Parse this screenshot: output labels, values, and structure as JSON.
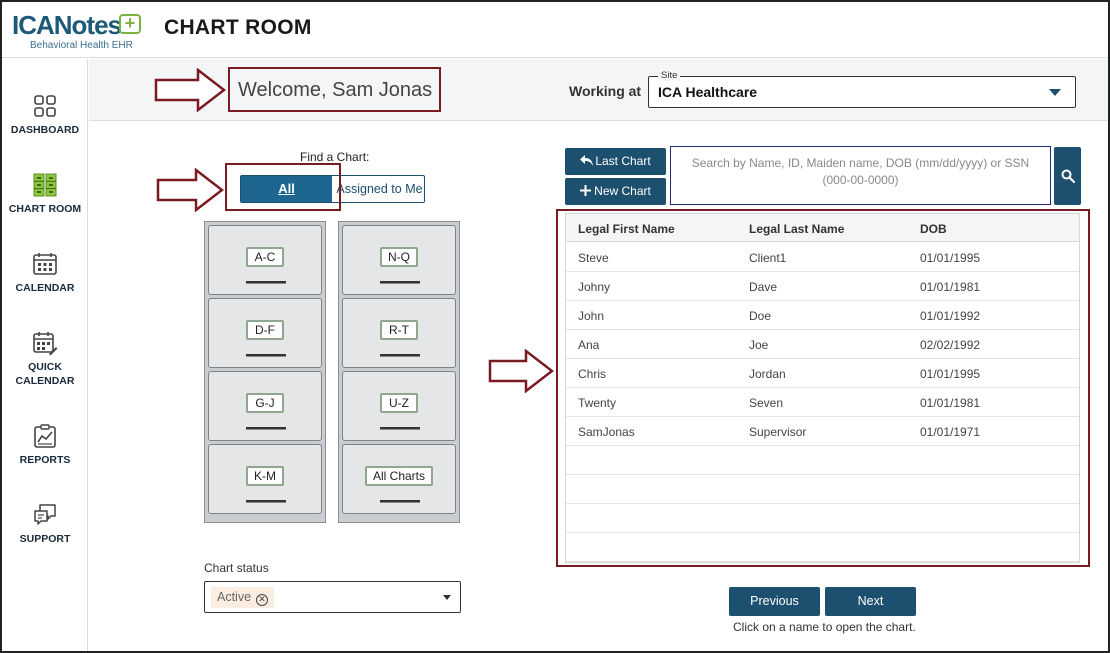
{
  "header": {
    "logo_brand": "ICANotes",
    "logo_plus": "+",
    "logo_tagline": "Behavioral Health EHR",
    "title": "CHART ROOM"
  },
  "sidebar": {
    "items": [
      {
        "label": "DASHBOARD",
        "icon": "dashboard-grid-icon"
      },
      {
        "label": "CHART ROOM",
        "icon": "file-cabinet-icon",
        "active": true
      },
      {
        "label": "CALENDAR",
        "icon": "calendar-icon"
      },
      {
        "label": "QUICK CALENDAR",
        "icon": "quick-calendar-icon"
      },
      {
        "label": "REPORTS",
        "icon": "reports-icon"
      },
      {
        "label": "SUPPORT",
        "icon": "support-chat-icon"
      }
    ]
  },
  "welcome": {
    "text": "Welcome, Sam Jonas",
    "working_at_label": "Working at",
    "site_legend": "Site",
    "site_value": "ICA Healthcare"
  },
  "find_chart": {
    "label": "Find a Chart:",
    "toggle_all": "All",
    "toggle_assigned": "Assigned to Me"
  },
  "cabinets": {
    "left": [
      "A-C",
      "D-F",
      "G-J",
      "K-M"
    ],
    "right": [
      "N-Q",
      "R-T",
      "U-Z",
      "All Charts"
    ]
  },
  "chart_status": {
    "label": "Chart status",
    "chip": "Active"
  },
  "actions": {
    "last_chart": "Last Chart",
    "new_chart": "New Chart",
    "search_placeholder": "Search by Name, ID, Maiden name, DOB (mm/dd/yyyy) or SSN (000-00-0000)"
  },
  "table": {
    "headers": [
      "Legal First Name",
      "Legal Last Name",
      "DOB"
    ],
    "rows": [
      [
        "Steve",
        "Client1",
        "01/01/1995"
      ],
      [
        "Johny",
        "Dave",
        "01/01/1981"
      ],
      [
        "John",
        "Doe",
        "01/01/1992"
      ],
      [
        "Ana",
        "Joe",
        "02/02/1992"
      ],
      [
        "Chris",
        "Jordan",
        "01/01/1995"
      ],
      [
        "Twenty",
        "Seven",
        "01/01/1981"
      ],
      [
        "SamJonas",
        "Supervisor",
        "01/01/1971"
      ]
    ]
  },
  "pager": {
    "previous": "Previous",
    "next": "Next",
    "hint": "Click on a name to open the chart."
  },
  "colors": {
    "primary": "#1d4f6e",
    "toggle_active": "#1d6690",
    "annotation": "#7a1b22",
    "accent_green": "#7bb241"
  }
}
